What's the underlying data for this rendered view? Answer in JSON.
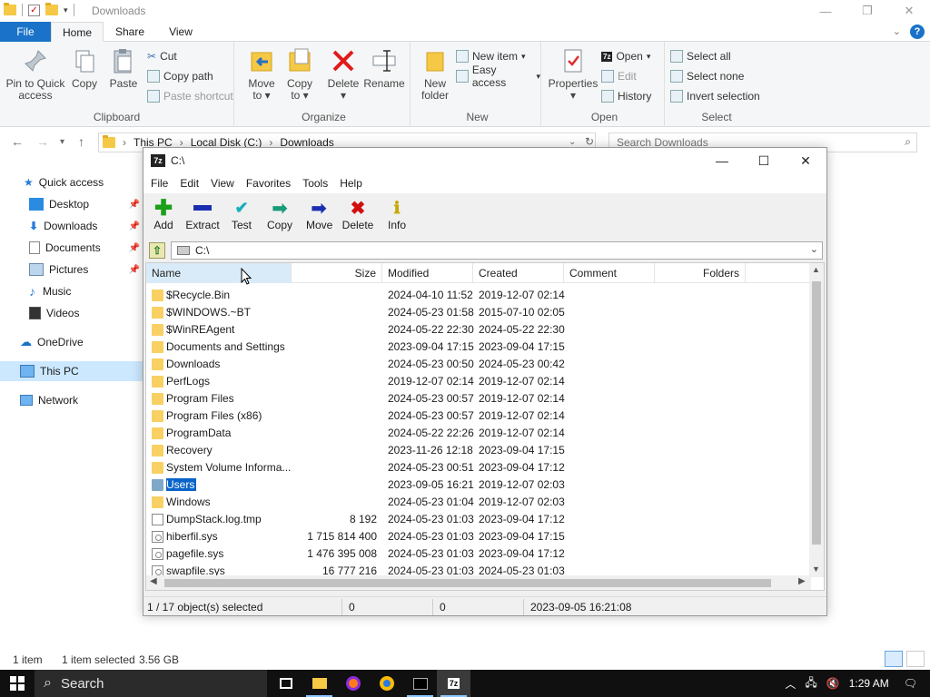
{
  "explorer": {
    "title": "Downloads",
    "tabs": {
      "file": "File",
      "home": "Home",
      "share": "Share",
      "view": "View"
    },
    "ribbon": {
      "clipboard": {
        "label": "Clipboard",
        "pin": "Pin to Quick access",
        "copy": "Copy",
        "paste": "Paste",
        "cut": "Cut",
        "copy_path": "Copy path",
        "paste_shortcut": "Paste shortcut"
      },
      "organize": {
        "label": "Organize",
        "move_to": "Move to",
        "copy_to": "Copy to",
        "delete": "Delete",
        "rename": "Rename"
      },
      "new": {
        "label": "New",
        "new_folder": "New folder",
        "new_item": "New item",
        "easy_access": "Easy access"
      },
      "open": {
        "label": "Open",
        "properties": "Properties",
        "open": "Open",
        "edit": "Edit",
        "history": "History"
      },
      "select": {
        "label": "Select",
        "select_all": "Select all",
        "select_none": "Select none",
        "invert": "Invert selection"
      }
    },
    "address": {
      "crumbs": [
        "This PC",
        "Local Disk (C:)",
        "Downloads"
      ]
    },
    "search_placeholder": "Search Downloads",
    "nav": [
      {
        "label": "Quick access",
        "icon": "star-icon"
      },
      {
        "label": "Desktop",
        "icon": "desktop-icon"
      },
      {
        "label": "Downloads",
        "icon": "download-icon"
      },
      {
        "label": "Documents",
        "icon": "document-icon"
      },
      {
        "label": "Pictures",
        "icon": "picture-icon"
      },
      {
        "label": "Music",
        "icon": "music-icon"
      },
      {
        "label": "Videos",
        "icon": "video-icon"
      },
      {
        "label": "OneDrive",
        "icon": "cloud-icon"
      },
      {
        "label": "This PC",
        "icon": "computer-icon"
      },
      {
        "label": "Network",
        "icon": "network-icon"
      }
    ],
    "status": {
      "count": "1 item",
      "selected": "1 item selected",
      "size": "3.56 GB"
    }
  },
  "sevenzip": {
    "title": "C:\\",
    "menu": [
      "File",
      "Edit",
      "View",
      "Favorites",
      "Tools",
      "Help"
    ],
    "toolbar": [
      "Add",
      "Extract",
      "Test",
      "Copy",
      "Move",
      "Delete",
      "Info"
    ],
    "path": "C:\\",
    "columns": {
      "name": "Name",
      "size": "Size",
      "modified": "Modified",
      "created": "Created",
      "comment": "Comment",
      "folders": "Folders"
    },
    "rows": [
      {
        "name": "$Recycle.Bin",
        "size": "",
        "modified": "2024-04-10 11:52",
        "created": "2019-12-07 02:14",
        "type": "folder"
      },
      {
        "name": "$WINDOWS.~BT",
        "size": "",
        "modified": "2024-05-23 01:58",
        "created": "2015-07-10 02:05",
        "type": "folder"
      },
      {
        "name": "$WinREAgent",
        "size": "",
        "modified": "2024-05-22 22:30",
        "created": "2024-05-22 22:30",
        "type": "folder"
      },
      {
        "name": "Documents and Settings",
        "size": "",
        "modified": "2023-09-04 17:15",
        "created": "2023-09-04 17:15",
        "type": "folder"
      },
      {
        "name": "Downloads",
        "size": "",
        "modified": "2024-05-23 00:50",
        "created": "2024-05-23 00:42",
        "type": "folder"
      },
      {
        "name": "PerfLogs",
        "size": "",
        "modified": "2019-12-07 02:14",
        "created": "2019-12-07 02:14",
        "type": "folder"
      },
      {
        "name": "Program Files",
        "size": "",
        "modified": "2024-05-23 00:57",
        "created": "2019-12-07 02:14",
        "type": "folder"
      },
      {
        "name": "Program Files (x86)",
        "size": "",
        "modified": "2024-05-23 00:57",
        "created": "2019-12-07 02:14",
        "type": "folder"
      },
      {
        "name": "ProgramData",
        "size": "",
        "modified": "2024-05-22 22:26",
        "created": "2019-12-07 02:14",
        "type": "folder"
      },
      {
        "name": "Recovery",
        "size": "",
        "modified": "2023-11-26 12:18",
        "created": "2023-09-04 17:15",
        "type": "folder"
      },
      {
        "name": "System Volume Informa...",
        "size": "",
        "modified": "2024-05-23 00:51",
        "created": "2023-09-04 17:12",
        "type": "folder"
      },
      {
        "name": "Users",
        "size": "",
        "modified": "2023-09-05 16:21",
        "created": "2019-12-07 02:03",
        "type": "folder",
        "selected": true
      },
      {
        "name": "Windows",
        "size": "",
        "modified": "2024-05-23 01:04",
        "created": "2019-12-07 02:03",
        "type": "folder"
      },
      {
        "name": "DumpStack.log.tmp",
        "size": "8 192",
        "modified": "2024-05-23 01:03",
        "created": "2023-09-04 17:12",
        "type": "file"
      },
      {
        "name": "hiberfil.sys",
        "size": "1 715 814 400",
        "modified": "2024-05-23 01:03",
        "created": "2023-09-04 17:15",
        "type": "sys"
      },
      {
        "name": "pagefile.sys",
        "size": "1 476 395 008",
        "modified": "2024-05-23 01:03",
        "created": "2023-09-04 17:12",
        "type": "sys"
      },
      {
        "name": "swapfile.sys",
        "size": "16 777 216",
        "modified": "2024-05-23 01:03",
        "created": "2024-05-23 01:03",
        "type": "sys"
      }
    ],
    "status": {
      "selected": "1 / 17 object(s) selected",
      "size": "0",
      "packed": "0",
      "date": "2023-09-05 16:21:08"
    }
  },
  "taskbar": {
    "search": "Search",
    "time": "1:29 AM"
  }
}
